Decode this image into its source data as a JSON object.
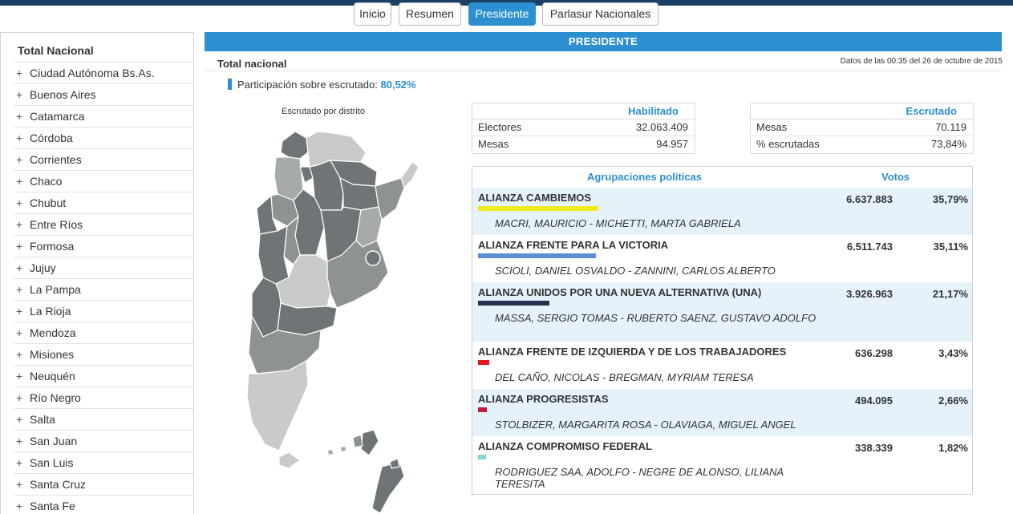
{
  "nav": {
    "tabs": [
      {
        "label": "Inicio"
      },
      {
        "label": "Resumen"
      },
      {
        "label": "Presidente"
      },
      {
        "label": "Parlasur Nacionales"
      }
    ]
  },
  "sidebar": {
    "title": "Total Nacional",
    "items": [
      "Ciudad Autónoma Bs.As.",
      "Buenos Aires",
      "Catamarca",
      "Córdoba",
      "Corrientes",
      "Chaco",
      "Chubut",
      "Entre Ríos",
      "Formosa",
      "Jujuy",
      "La Pampa",
      "La Rioja",
      "Mendoza",
      "Misiones",
      "Neuquén",
      "Río Negro",
      "Salta",
      "San Juan",
      "San Luis",
      "Santa Cruz",
      "Santa Fe"
    ],
    "plus": "+"
  },
  "main": {
    "header": "PRESIDENTE",
    "section_title": "Total nacional",
    "datos": "Datos de las 00:35 del 26 de octubre de 2015",
    "participacion_label": "Participación sobre escrutado:",
    "participacion_value": "80,52%",
    "map_label": "Escrutado por distrito"
  },
  "habilitado": {
    "header": "Habilitado",
    "rows": [
      {
        "label": "Electores",
        "value": "32.063.409"
      },
      {
        "label": "Mesas",
        "value": "94.957"
      }
    ]
  },
  "escrutado": {
    "header": "Escrutado",
    "rows": [
      {
        "label": "Mesas",
        "value": "70.119"
      },
      {
        "label": "% escrutadas",
        "value": "73,84%"
      }
    ]
  },
  "results": {
    "col_parties": "Agrupaciones políticas",
    "col_votes": "Votos",
    "rows": [
      {
        "party": "ALIANZA CAMBIEMOS",
        "candidates": "MACRI, MAURICIO - MICHETTI, MARTA GABRIELA",
        "votes": "6.637.883",
        "pct": "35,79%",
        "color": "#f2ea1f",
        "swatch_fraction": 0.3579
      },
      {
        "party": "ALIANZA FRENTE PARA LA VICTORIA",
        "candidates": "SCIOLI, DANIEL OSVALDO - ZANNINI, CARLOS ALBERTO",
        "votes": "6.511.743",
        "pct": "35,11%",
        "color": "#5b8fd1",
        "swatch_fraction": 0.3511
      },
      {
        "party": "ALIANZA UNIDOS POR UNA NUEVA ALTERNATIVA (UNA)",
        "candidates": "MASSA, SERGIO TOMAS - RUBERTO SAENZ, GUSTAVO ADOLFO",
        "votes": "3.926.963",
        "pct": "21,17%",
        "color": "#26304f",
        "swatch_fraction": 0.2117
      },
      {
        "party": "ALIANZA FRENTE DE IZQUIERDA Y DE LOS TRABAJADORES",
        "candidates": "DEL CAÑO, NICOLAS - BREGMAN, MYRIAM TERESA",
        "votes": "636.298",
        "pct": "3,43%",
        "color": "#e8141b",
        "swatch_fraction": 0.0343
      },
      {
        "party": "ALIANZA PROGRESISTAS",
        "candidates": "STOLBIZER, MARGARITA ROSA - OLAVIAGA, MIGUEL ANGEL",
        "votes": "494.095",
        "pct": "2,66%",
        "color": "#c4173a",
        "swatch_fraction": 0.0266
      },
      {
        "party": "ALIANZA COMPROMISO FEDERAL",
        "candidates": "RODRIGUEZ SAA, ADOLFO - NEGRE DE ALONSO, LILIANA TERESITA",
        "votes": "338.339",
        "pct": "1,82%",
        "color": "#82d3e0",
        "swatch_fraction": 0.0182
      }
    ]
  }
}
